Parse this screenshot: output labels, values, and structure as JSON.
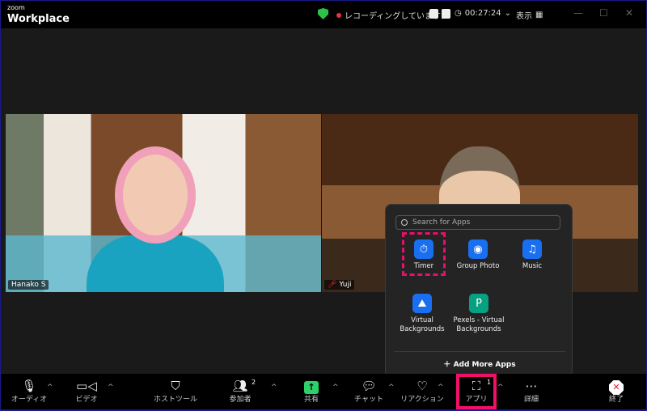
{
  "app": {
    "brand_small": "zoom",
    "brand": "Workplace"
  },
  "titlebar": {
    "recording": "レコーディングしています...",
    "timer": "00:27:24",
    "view": "表示",
    "minimize": "—",
    "maximize": "☐",
    "close": "✕"
  },
  "participants": [
    {
      "name": "Hanako S"
    },
    {
      "name": "Yuji"
    }
  ],
  "apps_panel": {
    "search_placeholder": "Search for Apps",
    "apps": [
      {
        "label": "Timer",
        "icon": "timer-icon",
        "color": "#1a6ff0",
        "glyph": "⏱"
      },
      {
        "label": "Group Photo",
        "icon": "camera-icon",
        "color": "#1a6ff0",
        "glyph": "◉"
      },
      {
        "label": "Music",
        "icon": "music-icon",
        "color": "#1a6ff0",
        "glyph": "♫"
      },
      {
        "label": "Virtual Backgrounds",
        "icon": "landscape-icon",
        "color": "#1a6ff0",
        "glyph": "⛰"
      },
      {
        "label": "Pexels - Virtual Backgrounds",
        "icon": "pexels-icon",
        "color": "#07a081",
        "glyph": "P"
      }
    ],
    "add_more": "Add More Apps"
  },
  "toolbar": {
    "audio": "オーディオ",
    "video": "ビデオ",
    "host_tools": "ホストツール",
    "participants": "参加者",
    "participants_count": "2",
    "share": "共有",
    "chat": "チャット",
    "reactions": "リアクション",
    "apps": "アプリ",
    "apps_count": "1",
    "more": "詳細",
    "end": "終了"
  },
  "colors": {
    "highlight": "#f0106a",
    "share": "#2ed06a",
    "recording": "#e33333"
  }
}
